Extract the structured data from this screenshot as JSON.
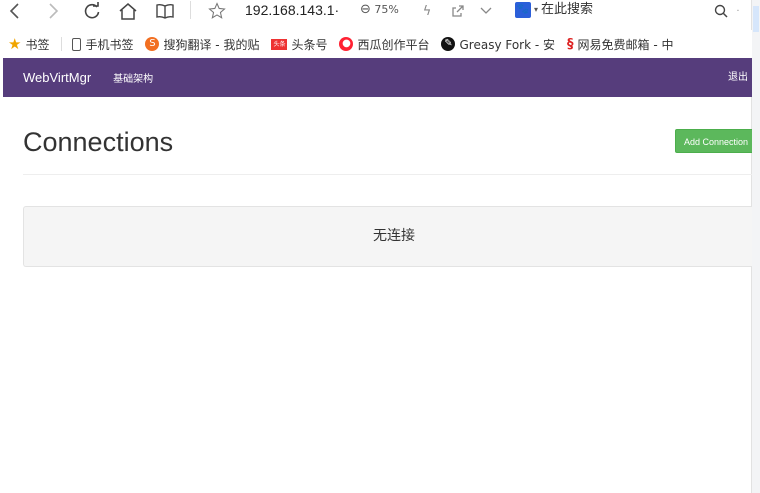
{
  "browser": {
    "url": "192.168.143.1·",
    "zoom": "75%",
    "search_placeholder": "在此搜索"
  },
  "bookmarks": [
    {
      "label": "书签",
      "icon": "star-icon"
    },
    {
      "label": "手机书签",
      "icon": "phone-icon"
    },
    {
      "label": "搜狗翻译 - 我的贴",
      "icon": "sogou-icon"
    },
    {
      "label": "头条号",
      "icon": "toutiao-icon"
    },
    {
      "label": "西瓜创作平台",
      "icon": "xigua-icon"
    },
    {
      "label": "Greasy Fork - 安",
      "icon": "greasyfork-icon"
    },
    {
      "label": "网易免费邮箱 - 中",
      "icon": "netease-icon"
    }
  ],
  "navbar": {
    "brand": "WebVirtMgr",
    "link": "基础架构",
    "logout": "退出"
  },
  "main": {
    "title": "Connections",
    "add_button": "Add Connection",
    "empty_message": "无连接"
  },
  "colors": {
    "navbar": "#563d7c",
    "add_button": "#5cb85c",
    "well": "#f5f5f5"
  }
}
